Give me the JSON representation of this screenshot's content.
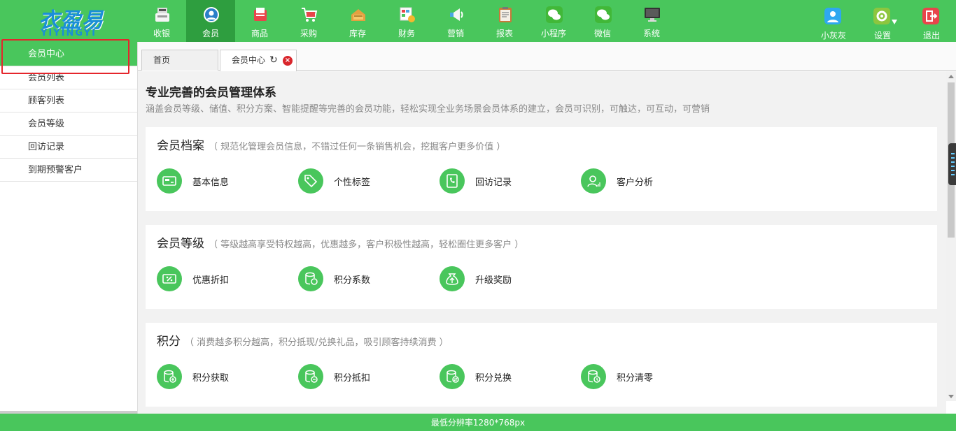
{
  "logo": {
    "cn": "衣盈易",
    "en": "YIYINGYI"
  },
  "nav": [
    {
      "label": "收银",
      "icon": "cash-register-icon"
    },
    {
      "label": "会员",
      "icon": "member-icon"
    },
    {
      "label": "商品",
      "icon": "goods-icon"
    },
    {
      "label": "采购",
      "icon": "cart-icon"
    },
    {
      "label": "库存",
      "icon": "inventory-icon"
    },
    {
      "label": "财务",
      "icon": "finance-icon"
    },
    {
      "label": "营销",
      "icon": "megaphone-icon"
    },
    {
      "label": "报表",
      "icon": "report-icon"
    },
    {
      "label": "小程序",
      "icon": "wechat-icon"
    },
    {
      "label": "微信",
      "icon": "wechat-icon"
    },
    {
      "label": "系统",
      "icon": "monitor-icon"
    }
  ],
  "right_nav": {
    "user": "小灰灰",
    "settings": "设置",
    "logout": "退出"
  },
  "sidebar": {
    "items": [
      {
        "label": "会员中心"
      },
      {
        "label": "会员列表"
      },
      {
        "label": "顾客列表"
      },
      {
        "label": "会员等级"
      },
      {
        "label": "回访记录"
      },
      {
        "label": "到期预警客户"
      }
    ]
  },
  "tabs": {
    "home": "首页",
    "current": "会员中心",
    "close": "×",
    "refresh": "↻"
  },
  "main": {
    "title": "专业完善的会员管理体系",
    "subtitle": "涵盖会员等级、储值、积分方案、智能提醒等完善的会员功能，轻松实现全业务场景会员体系的建立，会员可识别，可触达，可互动，可营销",
    "sections": [
      {
        "title": "会员档案",
        "desc": "（ 规范化管理会员信息，不错过任何一条销售机会，挖掘客户更多价值 ）",
        "features": [
          {
            "name": "基本信息",
            "icon": "id-card-icon"
          },
          {
            "name": "个性标签",
            "icon": "tag-icon"
          },
          {
            "name": "回访记录",
            "icon": "phone-icon"
          },
          {
            "name": "客户分析",
            "icon": "user-analysis-icon"
          }
        ]
      },
      {
        "title": "会员等级",
        "desc": "（ 等级越高享受特权越高，优惠越多，客户积极性越高，轻松圈住更多客户 ）",
        "features": [
          {
            "name": "优惠折扣",
            "icon": "discount-icon"
          },
          {
            "name": "积分系数",
            "icon": "points-coefficient-icon"
          },
          {
            "name": "升级奖励",
            "icon": "upgrade-reward-icon"
          }
        ]
      },
      {
        "title": "积分",
        "desc": "（ 消费越多积分越高，积分抵现/兑换礼品，吸引顾客持续消费 ）",
        "features": [
          {
            "name": "积分获取",
            "icon": "points-get-icon"
          },
          {
            "name": "积分抵扣",
            "icon": "points-deduct-icon"
          },
          {
            "name": "积分兑换",
            "icon": "points-exchange-icon"
          },
          {
            "name": "积分清零",
            "icon": "points-clear-icon"
          }
        ]
      }
    ]
  },
  "footer": {
    "text": "最低分辨率1280*768px"
  },
  "colors": {
    "brand_green": "#49c65c",
    "active_nav": "#2e9e3f",
    "highlight_red": "#e5262c"
  }
}
